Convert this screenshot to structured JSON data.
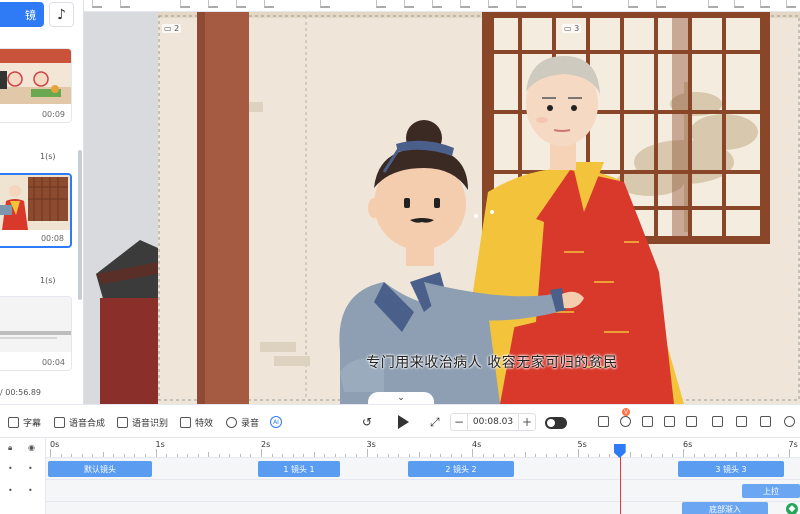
{
  "left_panel": {
    "primary_button_label": "镜",
    "music_icon": "music-note-icon",
    "scenes": [
      {
        "duration": "00:09"
      },
      {
        "duration": "00:08"
      },
      {
        "duration": "00:04"
      }
    ],
    "transitions": [
      "1(s)",
      "1(s)"
    ],
    "total_time": "/ 00:56.89"
  },
  "canvas": {
    "camera_markers": [
      "2",
      "3"
    ],
    "subtitle": "专门用来收治病人 收容无家可归的贫民"
  },
  "control_bar": {
    "tools": [
      {
        "icon": "subtitle-icon",
        "label": "字幕"
      },
      {
        "icon": "voice-synthesis-icon",
        "label": "语音合成"
      },
      {
        "icon": "voice-recognition-icon",
        "label": "语音识别"
      },
      {
        "icon": "effects-icon",
        "label": "特效"
      },
      {
        "icon": "microphone-icon",
        "label": "录音"
      }
    ],
    "ai_label": "AI",
    "time_value": "00:08.03",
    "minus_label": "−",
    "plus_label": "+",
    "badge_value": "V"
  },
  "timeline": {
    "ruler_ticks": [
      "0s",
      "1s",
      "2s",
      "3s",
      "4s",
      "5s",
      "6s",
      "7s"
    ],
    "camera_clips": [
      "默认镜头",
      "1 镜头 1",
      "2 镜头 2",
      "3 镜头 3"
    ],
    "effect_clips": [
      "上拉",
      "底部渐入"
    ],
    "playhead_time": 5.4
  },
  "colors": {
    "accent": "#2f7bf5",
    "clip": "#5a9cf0",
    "playhead": "#e53935",
    "wall": "#efe6d9",
    "pillar": "#a55a42",
    "robe_red": "#d8392b",
    "robe_yellow": "#f2c33b",
    "robe_gray": "#8e9fb3"
  }
}
